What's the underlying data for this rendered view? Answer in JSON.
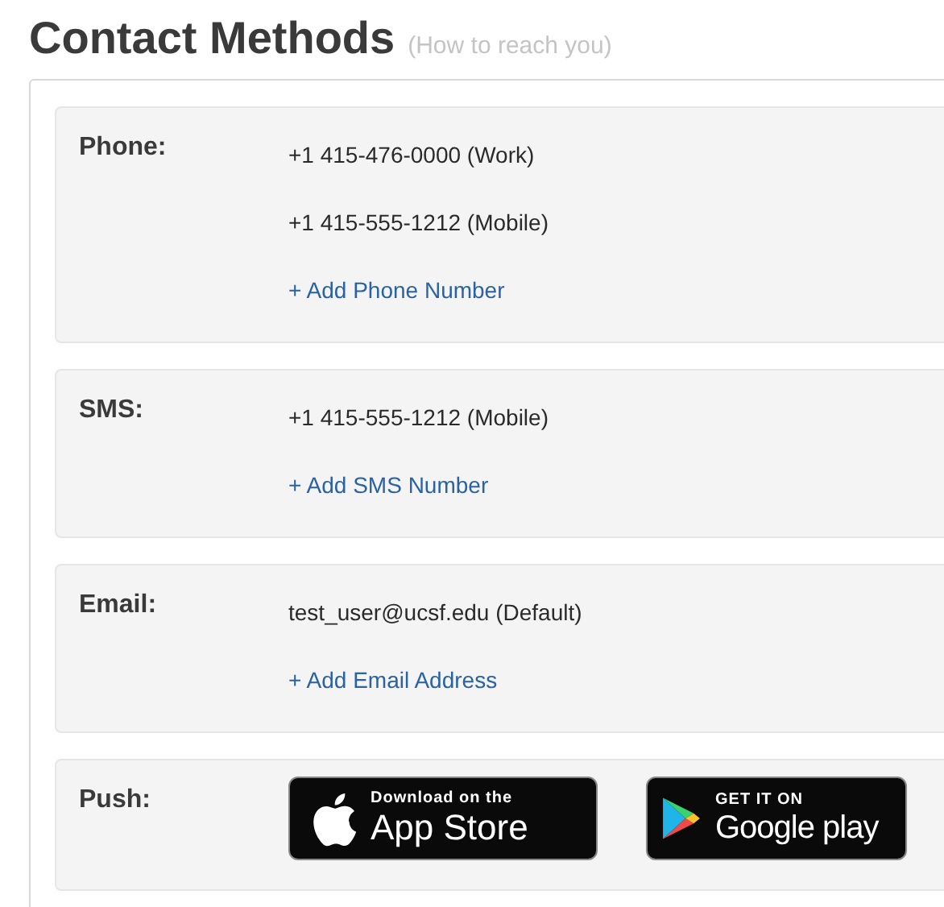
{
  "heading": {
    "title": "Contact Methods",
    "subtitle": "(How to reach you)"
  },
  "sections": [
    {
      "label": "Phone:",
      "kind": "entries",
      "items": [
        {
          "kind": "text",
          "text": "+1 415-476-0000 (Work)"
        },
        {
          "kind": "text",
          "text": "+1 415-555-1212 (Mobile)"
        },
        {
          "kind": "link",
          "text": "+ Add Phone Number"
        }
      ]
    },
    {
      "label": "SMS:",
      "kind": "entries",
      "items": [
        {
          "kind": "text",
          "text": "+1 415-555-1212 (Mobile)"
        },
        {
          "kind": "link",
          "text": "+ Add SMS Number"
        }
      ]
    },
    {
      "label": "Email:",
      "kind": "entries",
      "items": [
        {
          "kind": "text",
          "text": "test_user@ucsf.edu (Default)"
        },
        {
          "kind": "link",
          "text": "+ Add Email Address"
        }
      ]
    },
    {
      "label": "Push:",
      "kind": "badges",
      "badges": [
        {
          "kind": "apple",
          "small": "Download on the",
          "big": "App Store"
        },
        {
          "kind": "google",
          "small": "GET IT ON",
          "big": "Google play"
        }
      ]
    }
  ]
}
